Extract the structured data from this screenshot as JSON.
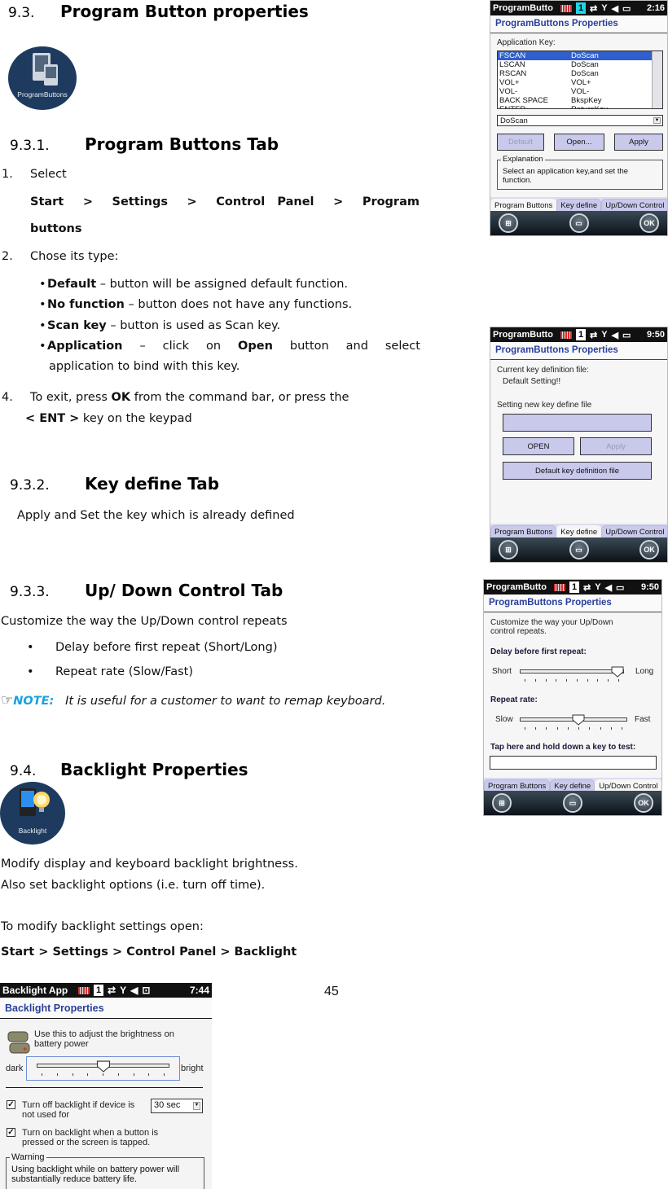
{
  "page_number": "45",
  "section_9_3": {
    "number": "9.3.",
    "title": "Program Button properties",
    "icon_label": "ProgramButtons"
  },
  "section_9_3_1": {
    "number": "9.3.1.",
    "title": "Program Buttons Tab",
    "step1_num": "1.",
    "step1_text": "Select",
    "step1_path": [
      "Start",
      ">",
      "Settings",
      ">",
      "Control",
      "Panel",
      ">",
      "Program"
    ],
    "step1_path_cont": "buttons",
    "step2_num": "2.",
    "step2_text": "Chose its type:",
    "types": [
      {
        "term": "Default",
        "desc": " – button will be assigned default function."
      },
      {
        "term": "No function",
        "desc": " – button does not have any functions."
      },
      {
        "term": "Scan key",
        "desc": " – button is used as Scan key."
      }
    ],
    "app_type": {
      "term": "Application",
      "mid": "  –  click  on  ",
      "open": "Open",
      "desc": "  button  and  select",
      "cont": "application to bind with this key."
    },
    "step4_num": "4.",
    "step4_a": "To exit, press ",
    "step4_ok": "OK",
    "step4_b": " from the command bar, or press the",
    "step4_ent": "< ENT >",
    "step4_c": " key on the keypad"
  },
  "section_9_3_2": {
    "number": "9.3.2.",
    "title": "Key define Tab",
    "text": "Apply and Set the key which is already defined"
  },
  "section_9_3_3": {
    "number": "9.3.3.",
    "title": "Up/ Down Control Tab",
    "text": "Customize the way the Up/Down control repeats",
    "bullets": [
      "Delay before first repeat (Short/Long)",
      "Repeat rate (Slow/Fast)"
    ],
    "note_label": "NOTE:",
    "note_text": "It is useful for a customer to want to remap keyboard.",
    "note_color": "#1aa0e0"
  },
  "section_9_4": {
    "number": "9.4.",
    "title": "Backlight Properties",
    "icon_label": "Backlight",
    "line1": "Modify display and keyboard backlight brightness.",
    "line2": "Also set backlight options (i.e. turn off time).",
    "line3": "To modify backlight settings open:",
    "path": "Start > Settings > Control Panel > Backlight"
  },
  "screen1": {
    "status_title": "ProgramButto",
    "status_sim": "1",
    "time": "2:16",
    "header": "ProgramButtons Properties",
    "list_label": "Application Key:",
    "list_rows": [
      [
        "FSCAN",
        "DoScan"
      ],
      [
        "LSCAN",
        "DoScan"
      ],
      [
        "RSCAN",
        "DoScan"
      ],
      [
        "VOL+",
        "VOL+"
      ],
      [
        "VOL-",
        "VOL-"
      ],
      [
        "BACK SPACE",
        "BkspKey"
      ],
      [
        "ENTER",
        "ReturnKey"
      ]
    ],
    "selected_row": 0,
    "combo_value": "DoScan",
    "btn_default": "Default",
    "btn_open": "Open...",
    "btn_apply": "Apply",
    "explanation_legend": "Explanation",
    "explanation_text": "Select an application key,and set the function.",
    "tabs": [
      "Program Buttons",
      "Key define",
      "Up/Down Control"
    ],
    "active_tab": 0,
    "cmd_ok": "OK"
  },
  "screen2": {
    "status_title": "ProgramButto",
    "status_sim": "1",
    "time": "9:50",
    "header": "ProgramButtons Properties",
    "current_label": "Current key definition file:",
    "current_value": "Default Setting!!",
    "new_label": "Setting new key define file",
    "input_value": "",
    "btn_open": "OPEN",
    "btn_apply": "Apply",
    "btn_default_file": "Default key definition file",
    "tabs": [
      "Program Buttons",
      "Key define",
      "Up/Down Control"
    ],
    "active_tab": 1,
    "cmd_ok": "OK"
  },
  "screen3": {
    "status_title": "ProgramButto",
    "status_sim": "1",
    "time": "9:50",
    "header": "ProgramButtons Properties",
    "intro": "Customize the way your Up/Down control repeats.",
    "delay_label": "Delay before first repeat:",
    "delay_min": "Short",
    "delay_max": "Long",
    "delay_value": 1.0,
    "rate_label": "Repeat rate:",
    "rate_min": "Slow",
    "rate_max": "Fast",
    "rate_value": 0.55,
    "test_label": "Tap here and hold down a key to test:",
    "test_value": "",
    "tabs": [
      "Program Buttons",
      "Key define",
      "Up/Down Control"
    ],
    "active_tab": 2,
    "cmd_ok": "OK"
  },
  "screen4": {
    "status_title": "Backlight App",
    "status_sim": "1",
    "time": "7:44",
    "header": "Backlight Properties",
    "battery_text": "Use this to adjust the brightness on battery power",
    "slider_min": "dark",
    "slider_max": "bright",
    "brightness_value": 0.5,
    "chk1_label": "Turn off backlight if device is not used for",
    "chk1_checked": true,
    "timeout_value": "30 sec",
    "chk2_label": "Turn on backlight when a button is pressed or the screen is tapped.",
    "chk2_checked": true,
    "warning_legend": "Warning",
    "warning_text": "Using backlight while on battery power will substantially reduce battery life."
  }
}
